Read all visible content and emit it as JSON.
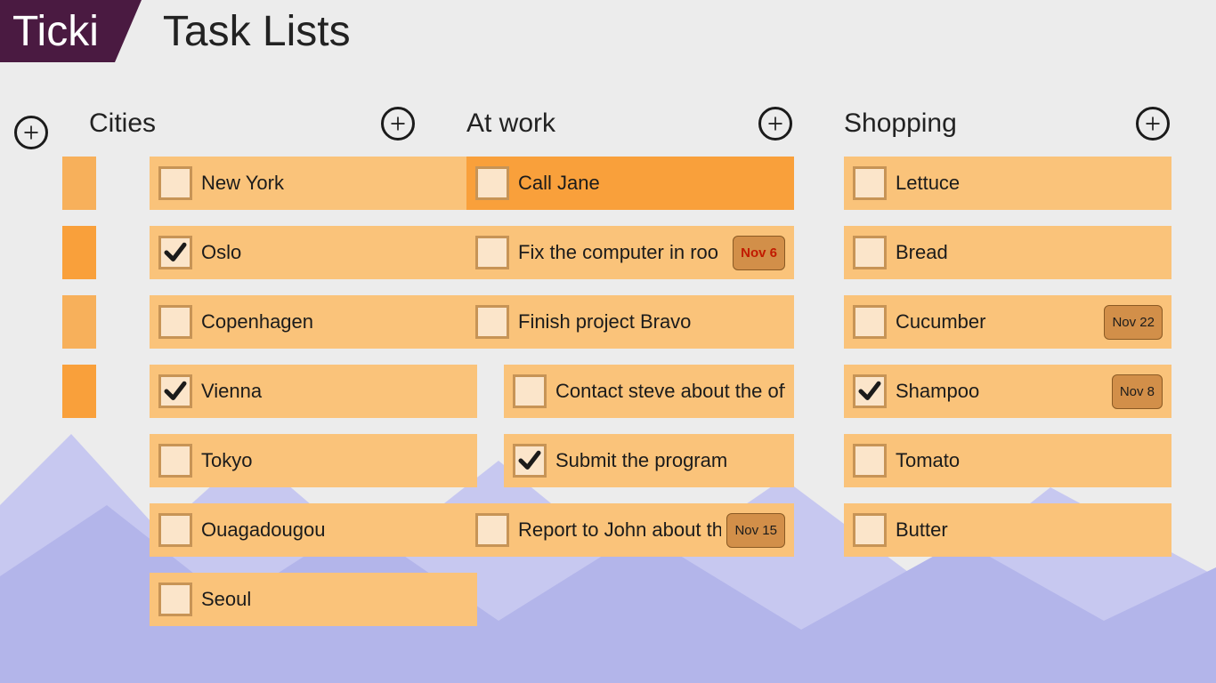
{
  "app": {
    "name": "Ticki",
    "page_title": "Task Lists"
  },
  "columns": [
    {
      "title": "Cities",
      "tasks": [
        {
          "label": "New York",
          "done": false,
          "sub": false,
          "highlight": false,
          "date": null,
          "overdue": false
        },
        {
          "label": "Oslo",
          "done": true,
          "sub": false,
          "highlight": false,
          "date": null,
          "overdue": false
        },
        {
          "label": "Copenhagen",
          "done": false,
          "sub": false,
          "highlight": false,
          "date": null,
          "overdue": false
        },
        {
          "label": "Vienna",
          "done": true,
          "sub": false,
          "highlight": false,
          "date": null,
          "overdue": false
        },
        {
          "label": "Tokyo",
          "done": false,
          "sub": false,
          "highlight": false,
          "date": null,
          "overdue": false
        },
        {
          "label": "Ouagadougou",
          "done": false,
          "sub": false,
          "highlight": false,
          "date": null,
          "overdue": false
        },
        {
          "label": "Seoul",
          "done": false,
          "sub": false,
          "highlight": false,
          "date": null,
          "overdue": false
        }
      ]
    },
    {
      "title": "At work",
      "tasks": [
        {
          "label": "Call Jane",
          "done": false,
          "sub": false,
          "highlight": true,
          "date": null,
          "overdue": false
        },
        {
          "label": "Fix the computer in roo",
          "done": false,
          "sub": false,
          "highlight": false,
          "date": "Nov 6",
          "overdue": true
        },
        {
          "label": "Finish project Bravo",
          "done": false,
          "sub": false,
          "highlight": false,
          "date": null,
          "overdue": false
        },
        {
          "label": "Contact steve about the off",
          "done": false,
          "sub": true,
          "highlight": false,
          "date": null,
          "overdue": false
        },
        {
          "label": "Submit the program",
          "done": true,
          "sub": true,
          "highlight": false,
          "date": null,
          "overdue": false
        },
        {
          "label": "Report to John about th",
          "done": false,
          "sub": false,
          "highlight": false,
          "date": "Nov 15",
          "overdue": false
        }
      ]
    },
    {
      "title": "Shopping",
      "tasks": [
        {
          "label": "Lettuce",
          "done": false,
          "sub": false,
          "highlight": false,
          "date": null,
          "overdue": false
        },
        {
          "label": "Bread",
          "done": false,
          "sub": false,
          "highlight": false,
          "date": null,
          "overdue": false
        },
        {
          "label": "Cucumber",
          "done": false,
          "sub": false,
          "highlight": false,
          "date": "Nov 22",
          "overdue": false
        },
        {
          "label": "Shampoo",
          "done": true,
          "sub": false,
          "highlight": false,
          "date": "Nov 8",
          "overdue": false
        },
        {
          "label": "Tomato",
          "done": false,
          "sub": false,
          "highlight": false,
          "date": null,
          "overdue": false
        },
        {
          "label": "Butter",
          "done": false,
          "sub": false,
          "highlight": false,
          "date": null,
          "overdue": false
        }
      ]
    }
  ]
}
